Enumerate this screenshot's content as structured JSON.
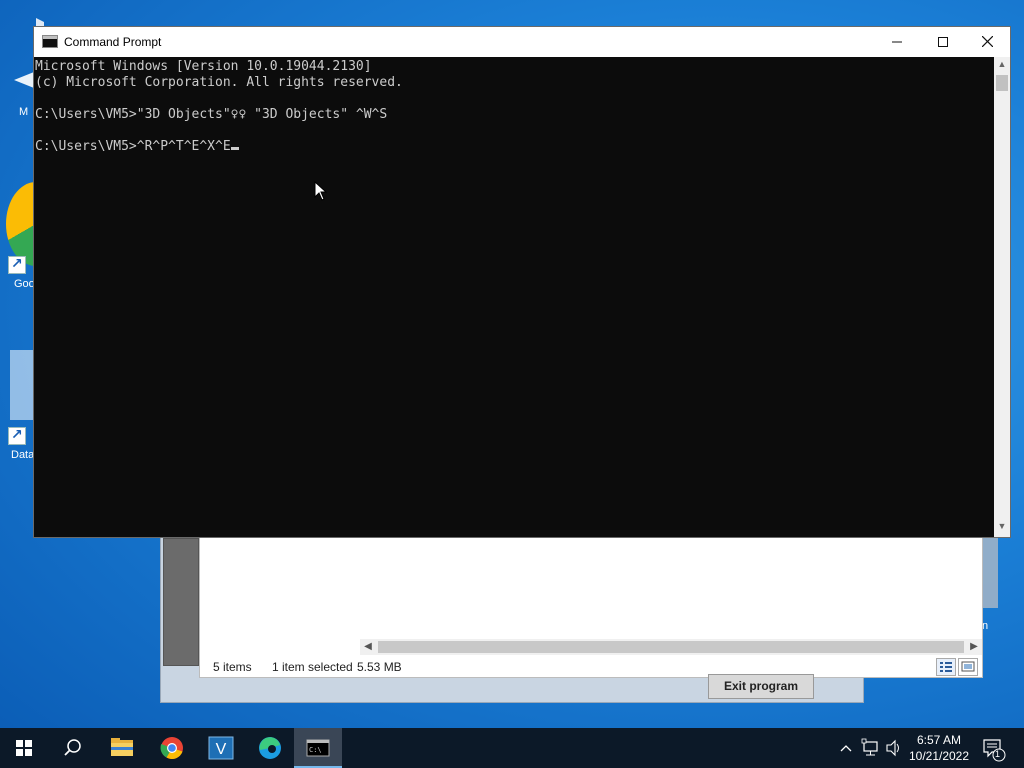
{
  "desktop": {
    "icons": [
      {
        "label": "M"
      },
      {
        "label": "Goo"
      },
      {
        "label": "Data"
      },
      {
        "label": "n"
      }
    ]
  },
  "background_app": {
    "status": {
      "items": "5 items",
      "selected": "1 item selected",
      "size": "5.53 MB"
    },
    "exit_button": "Exit program"
  },
  "cmd": {
    "title": "Command Prompt",
    "lines": [
      "Microsoft Windows [Version 10.0.19044.2130]",
      "(c) Microsoft Corporation. All rights reserved.",
      "",
      "C:\\Users\\VM5>\"3D Objects\"♀♀ \"3D Objects\" ^W^S",
      "",
      "C:\\Users\\VM5>^R^P^T^E^X^E"
    ]
  },
  "taskbar": {
    "clock_time": "6:57 AM",
    "clock_date": "10/21/2022",
    "notification_count": "1"
  },
  "colors": {
    "console_bg": "#0c0c0c",
    "console_fg": "#cccccc",
    "taskbar": "#0c1928"
  }
}
